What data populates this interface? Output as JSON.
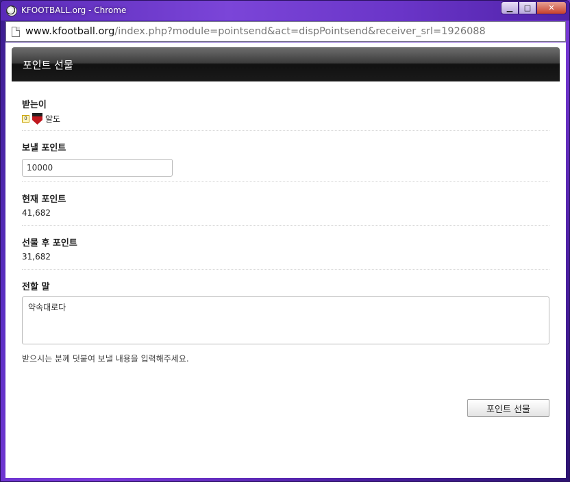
{
  "window": {
    "title": "KFOOTBALL.org - Chrome",
    "buttons": {
      "minimize": "▁",
      "maximize": "□",
      "close": "✕"
    }
  },
  "address": {
    "host": "www.kfootball.org",
    "path": "/index.php?module=pointsend&act=dispPointsend&receiver_srl=1926088"
  },
  "header": {
    "title": "포인트 선물"
  },
  "form": {
    "receiver": {
      "label": "받는이",
      "level": "0",
      "name": "알도"
    },
    "send_points": {
      "label": "보낼 포인트",
      "value": "10000"
    },
    "current_points": {
      "label": "현재 포인트",
      "value": "41,682"
    },
    "after_points": {
      "label": "선물 후 포인트",
      "value": "31,682"
    },
    "message": {
      "label": "전할 말",
      "value": "약속대로다",
      "hint": "받으시는 분께 덧붙여 보낼 내용을 입력해주세요."
    },
    "submit_label": "포인트 선물"
  }
}
